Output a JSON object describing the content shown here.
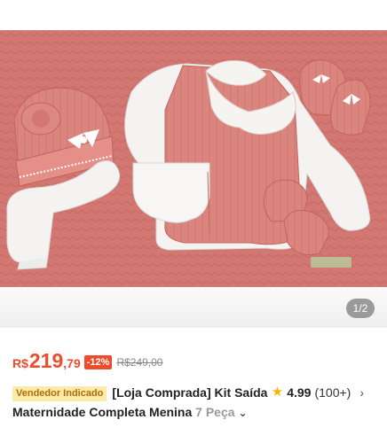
{
  "gallery": {
    "page_indicator": "1/2",
    "colors": {
      "background": "#d27772",
      "knit": "#d9837c",
      "garment_white": "#f4f3f1"
    }
  },
  "product": {
    "price_currency": "R$",
    "price_int": "219",
    "price_cents": ",79",
    "discount": "-12%",
    "original_price": "R$249,00",
    "badge": "Vendedor Indicado",
    "title_main": "[Loja Comprada] Kit Saída",
    "title_line2": "Maternidade Completa Menina",
    "title_fade": "7 Peça",
    "rating": "4.99",
    "rating_count": "(100+)",
    "colors": {
      "accent": "#ee4d2d",
      "star": "#f5b800",
      "badge_bg": "#fbeaa8"
    }
  }
}
